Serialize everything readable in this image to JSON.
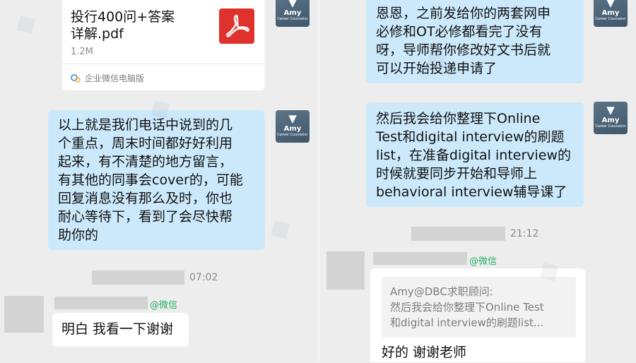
{
  "left_panel": {
    "file_message": {
      "file_name_lines": [
        "投行400问+答案",
        "详解.pdf"
      ],
      "file_size": "1.2M",
      "source_label": "企业微信电脑版"
    },
    "counselor_message_lines": [
      "以上就是我们电话中说到的几",
      "个重点，周末时间都好好利用",
      "起来，有不清楚的地方留言，",
      "有其他的同事会cover的，可能",
      "回复消息没有那么及时，你也",
      "耐心等待下，看到了会尽快帮",
      "助你的"
    ],
    "time_label": "07:02",
    "sender_tag": "@微信",
    "student_reply": "明白 我看一下谢谢"
  },
  "right_panel": {
    "counselor_message_1_lines": [
      "恩恩，之前发给你的两套网申",
      "必修和OT必修都看完了没有",
      "呀，导师帮你修改好文书后就",
      "可以开始投递申请了"
    ],
    "counselor_message_2_lines": [
      "然后我会给你整理下Online",
      "Test和digital interview的刷题",
      "list，在准备digital interview的",
      "时候就要同步开始和导师上",
      "behavioral interview辅导课了"
    ],
    "time_label": "21:12",
    "sender_tag": "@微信",
    "quote_lines": [
      "Amy@DBC求职顾问:",
      "然后我会给你整理下Online Test",
      "和digital interview的刷题list..."
    ],
    "student_reply": "好的 谢谢老师"
  },
  "avatar": {
    "name": "Amy",
    "subtitle": "Career Counselor"
  },
  "colors": {
    "counselor_bubble": "#cce9fb",
    "student_bubble": "#ffffff",
    "pdf_red": "#e0322c",
    "wechat_green": "#2aae67"
  }
}
